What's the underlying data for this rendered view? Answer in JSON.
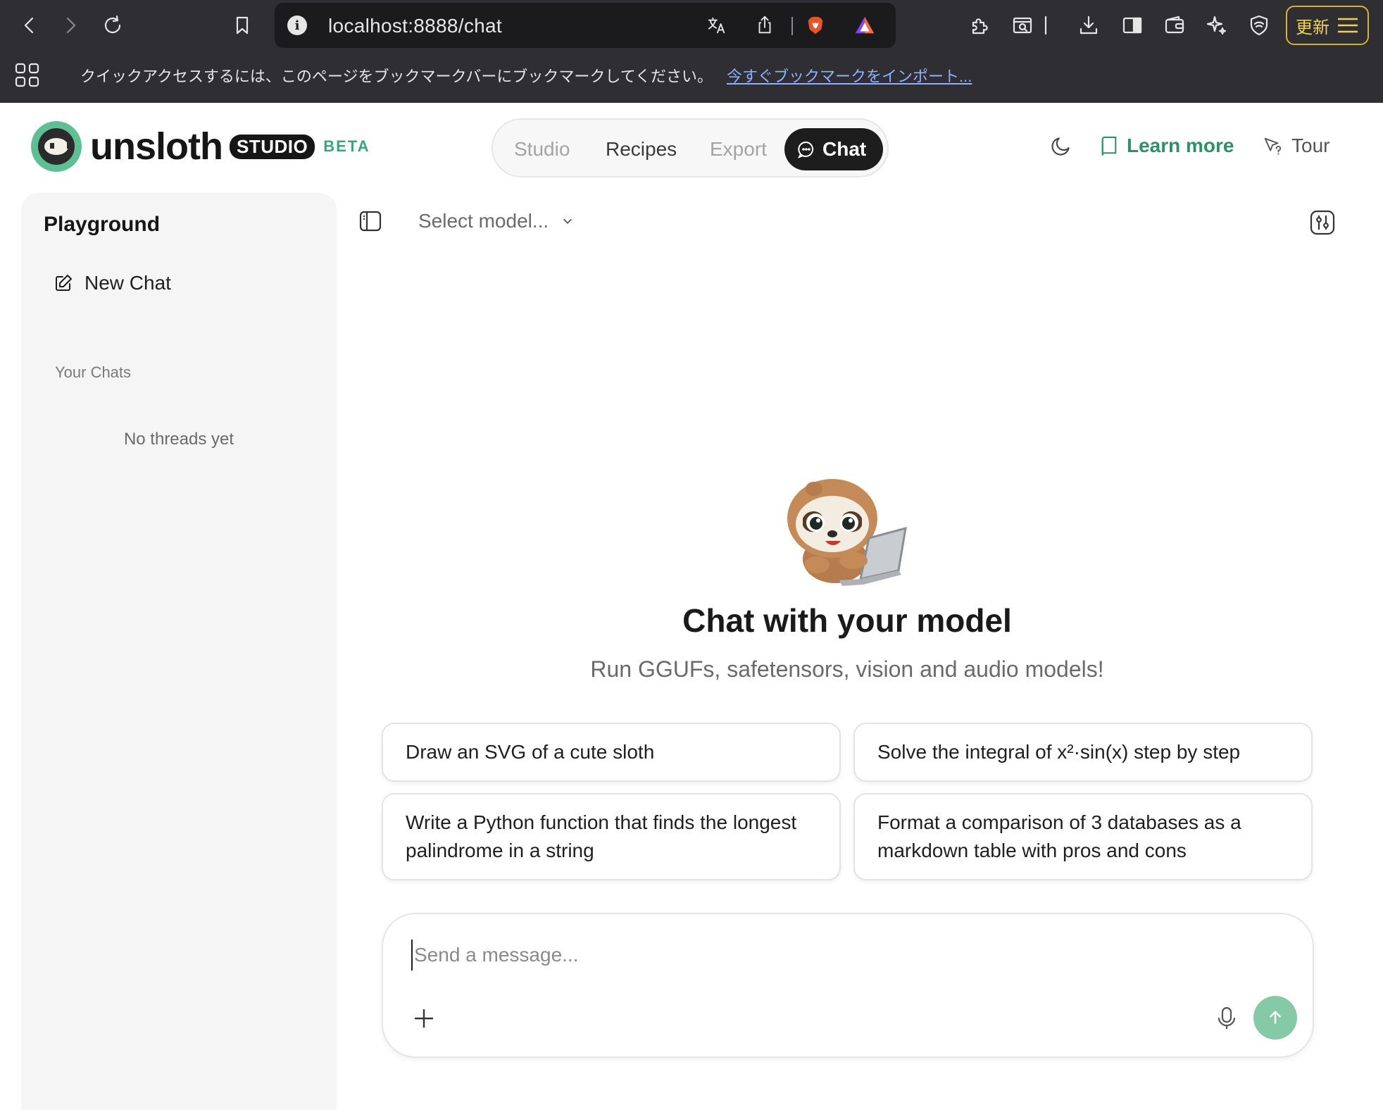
{
  "browser": {
    "url": "localhost:8888/chat",
    "update_label": "更新",
    "bookmark_prompt": "クイックアクセスするには、このページをブックマークバーにブックマークしてください。",
    "bookmark_import_link": "今すぐブックマークをインポート..."
  },
  "brand": {
    "name": "unsloth",
    "studio_badge": "STUDIO",
    "beta_label": "BETA",
    "accent_color": "#3aa57a"
  },
  "nav": {
    "tabs": [
      {
        "label": "Studio",
        "state": "disabled"
      },
      {
        "label": "Recipes",
        "state": "enabled"
      },
      {
        "label": "Export",
        "state": "disabled"
      },
      {
        "label": "Chat",
        "state": "active"
      }
    ]
  },
  "header": {
    "learn_more": "Learn more",
    "tour": "Tour"
  },
  "sidebar": {
    "title": "Playground",
    "new_chat": "New Chat",
    "section_label": "Your Chats",
    "empty_text": "No threads yet"
  },
  "main": {
    "model_select": "Select model...",
    "hero_title": "Chat with your model",
    "hero_subtitle": "Run GGUFs, safetensors, vision and audio models!",
    "suggestions": [
      "Draw an SVG of a cute sloth",
      "Solve the integral of x²·sin(x) step by step",
      "Write a Python function that finds the longest palindrome in a string",
      "Format a comparison of 3 databases as a markdown table with pros and cons"
    ]
  },
  "composer": {
    "placeholder": "Send a message...",
    "value": ""
  }
}
